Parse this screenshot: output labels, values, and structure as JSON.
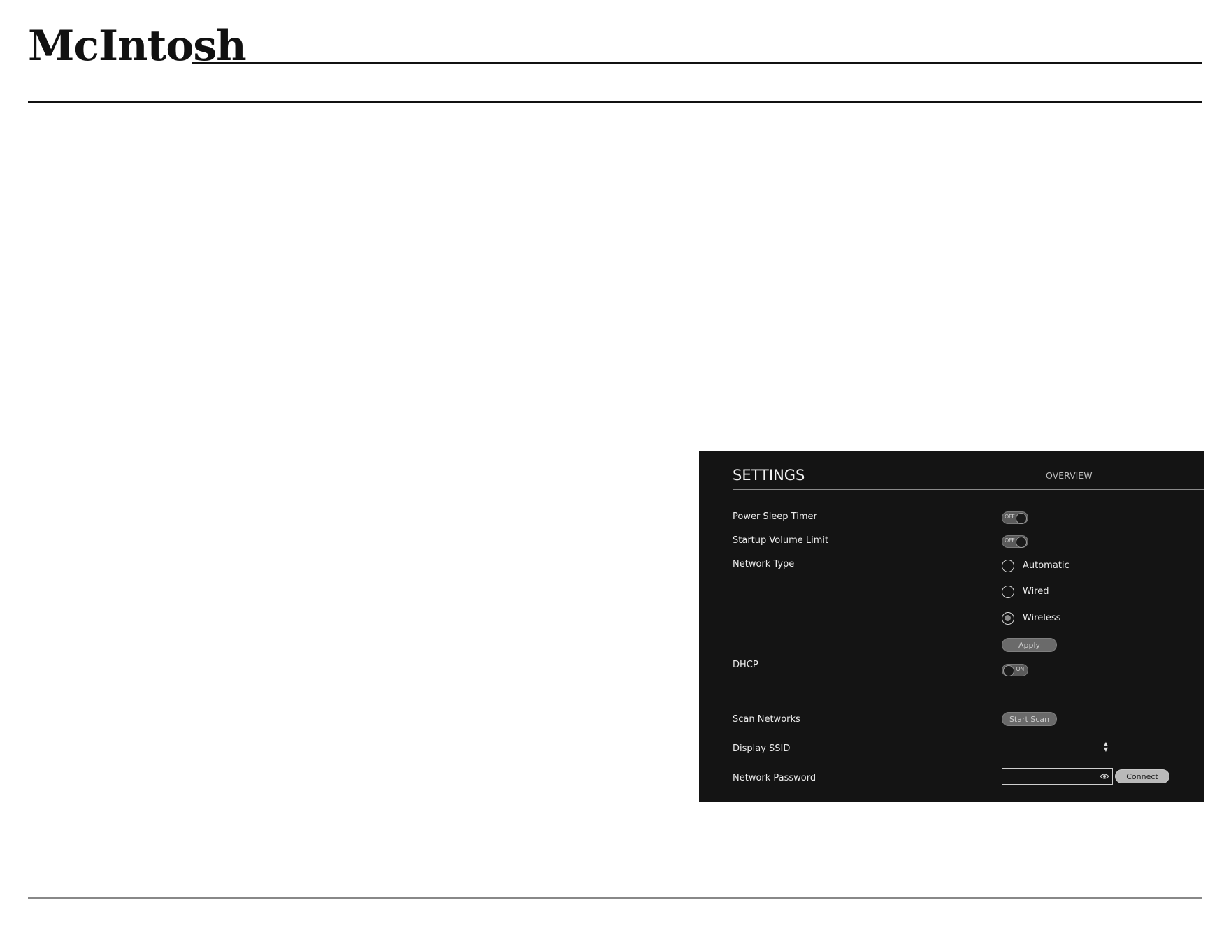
{
  "brand": {
    "logo_text": "McIntosh"
  },
  "settings": {
    "title": "SETTINGS",
    "overview_label": "OVERVIEW",
    "power_sleep_timer": {
      "label": "Power Sleep Timer",
      "state": "OFF"
    },
    "startup_volume_limit": {
      "label": "Startup Volume Limit",
      "state": "OFF"
    },
    "network_type": {
      "label": "Network Type",
      "options": [
        "Automatic",
        "Wired",
        "Wireless"
      ],
      "selected": "Wireless"
    },
    "apply_label": "Apply",
    "dhcp": {
      "label": "DHCP",
      "state": "ON"
    },
    "scan_networks": {
      "label": "Scan Networks",
      "button_label": "Start Scan"
    },
    "display_ssid": {
      "label": "Display SSID",
      "value": ""
    },
    "network_password": {
      "label": "Network Password",
      "value": "",
      "button_label": "Connect"
    }
  },
  "colors": {
    "panel_background": "#141414",
    "panel_text": "#e8e8e8",
    "button_grey": "#6a6a6a"
  },
  "icons": {
    "ssid_stepper": "up-down-arrows-icon",
    "password_reveal": "eye-icon"
  }
}
